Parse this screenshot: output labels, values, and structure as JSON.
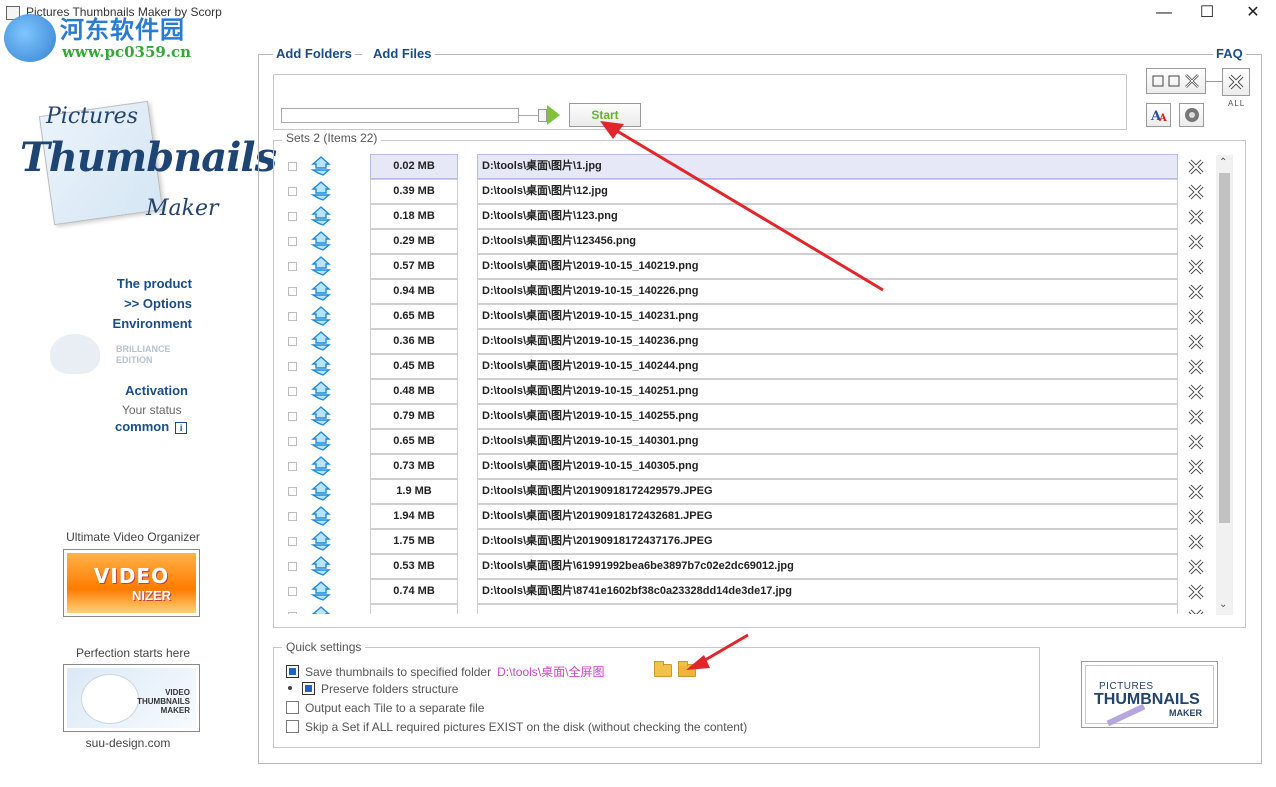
{
  "window": {
    "title": "Pictures Thumbnails Maker by Scorp",
    "watermark_cn": "河东软件园",
    "watermark_url": "www.pc0359.cn"
  },
  "logo": {
    "line1": "Pictures",
    "line2": "Thumbnails",
    "line3": "Maker"
  },
  "left_nav": {
    "product": "The product",
    "options": ">> Options",
    "environment": "Environment",
    "brilliance": "BRILLIANCE",
    "edition": "EDITION",
    "activation": "Activation",
    "your_status": "Your status",
    "status_value": "common",
    "info_glyph": "i"
  },
  "ads": {
    "video_label": "Ultimate Video Organizer",
    "video_big": "VIDEO",
    "video_small": "NIZER",
    "owl_label": "Perfection starts here",
    "owl_text1": "VIDEO",
    "owl_text2": "THUMBNAILS",
    "owl_text3": "MAKER",
    "site": "suu-design.com"
  },
  "top": {
    "add_folders": "Add Folders",
    "add_files": "Add Files",
    "faq": "FAQ",
    "start": "Start",
    "all": "ALL"
  },
  "list": {
    "header": "Sets 2 (Items 22)",
    "items": [
      {
        "size": "0.02 MB",
        "path": "D:\\tools\\桌面\\图片\\1.jpg",
        "selected": true
      },
      {
        "size": "0.39 MB",
        "path": "D:\\tools\\桌面\\图片\\12.jpg"
      },
      {
        "size": "0.18 MB",
        "path": "D:\\tools\\桌面\\图片\\123.png"
      },
      {
        "size": "0.29 MB",
        "path": "D:\\tools\\桌面\\图片\\123456.png"
      },
      {
        "size": "0.57 MB",
        "path": "D:\\tools\\桌面\\图片\\2019-10-15_140219.png"
      },
      {
        "size": "0.94 MB",
        "path": "D:\\tools\\桌面\\图片\\2019-10-15_140226.png"
      },
      {
        "size": "0.65 MB",
        "path": "D:\\tools\\桌面\\图片\\2019-10-15_140231.png"
      },
      {
        "size": "0.36 MB",
        "path": "D:\\tools\\桌面\\图片\\2019-10-15_140236.png"
      },
      {
        "size": "0.45 MB",
        "path": "D:\\tools\\桌面\\图片\\2019-10-15_140244.png"
      },
      {
        "size": "0.48 MB",
        "path": "D:\\tools\\桌面\\图片\\2019-10-15_140251.png"
      },
      {
        "size": "0.79 MB",
        "path": "D:\\tools\\桌面\\图片\\2019-10-15_140255.png"
      },
      {
        "size": "0.65 MB",
        "path": "D:\\tools\\桌面\\图片\\2019-10-15_140301.png"
      },
      {
        "size": "0.73 MB",
        "path": "D:\\tools\\桌面\\图片\\2019-10-15_140305.png"
      },
      {
        "size": "1.9 MB",
        "path": "D:\\tools\\桌面\\图片\\20190918172429579.JPEG"
      },
      {
        "size": "1.94 MB",
        "path": "D:\\tools\\桌面\\图片\\20190918172432681.JPEG"
      },
      {
        "size": "1.75 MB",
        "path": "D:\\tools\\桌面\\图片\\20190918172437176.JPEG"
      },
      {
        "size": "0.53 MB",
        "path": "D:\\tools\\桌面\\图片\\61991992bea6be3897b7c02e2dc69012.jpg"
      },
      {
        "size": "0.74 MB",
        "path": "D:\\tools\\桌面\\图片\\8741e1602bf38c0a23328dd14de3de17.jpg"
      }
    ]
  },
  "quick_settings": {
    "header": "Quick settings",
    "save_label": "Save thumbnails to specified folder",
    "save_path": "D:\\tools\\桌面\\全屏图",
    "preserve_label": "Preserve folders structure",
    "separate_label": "Output each Tile to a separate file",
    "skip_label": "Skip a Set if ALL required pictures EXIST on the disk (without checking the content)"
  },
  "brand": {
    "pictures": "PICTURES",
    "thumbnails": "THUMBNAILS",
    "maker": "MAKER"
  },
  "colors": {
    "accent_blue": "#1a4d86",
    "start_green": "#6ab02b",
    "arrow_red": "#e0262b",
    "path_magenta": "#c646c6"
  }
}
